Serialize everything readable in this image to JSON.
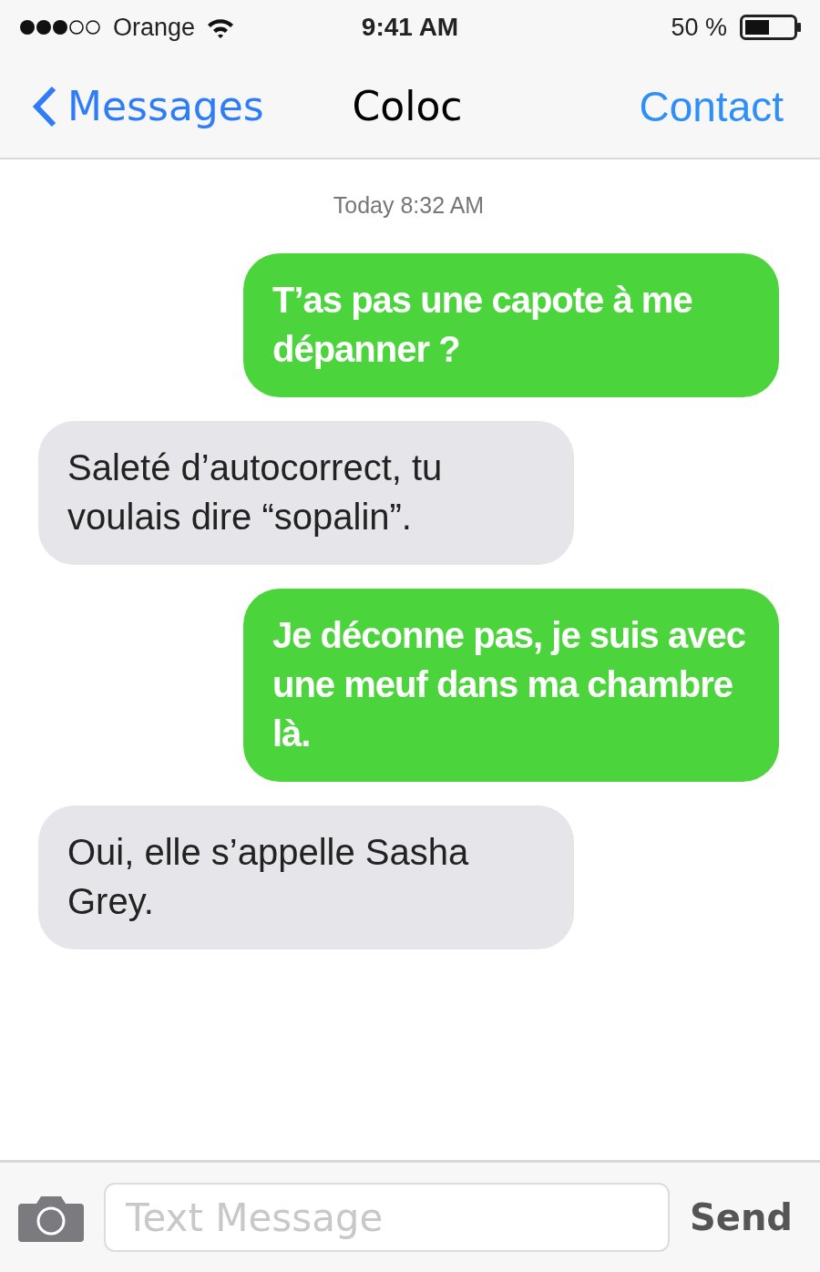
{
  "status_bar": {
    "carrier": "Orange",
    "time": "9:41 AM",
    "battery": "50 %"
  },
  "nav": {
    "back": "Messages",
    "title": "Coloc",
    "action": "Contact"
  },
  "timestamp": "Today 8:32 AM",
  "messages": [
    {
      "kind": "sent",
      "text": "T’as pas une capote à me dépanner ?"
    },
    {
      "kind": "received",
      "text": "Saleté d’autocorrect, tu voulais dire “sopalin”."
    },
    {
      "kind": "sent",
      "text": "Je déconne pas, je suis avec une meuf dans ma chambre là."
    },
    {
      "kind": "received",
      "text": "Oui, elle s’appelle Sasha Grey."
    }
  ],
  "composer": {
    "placeholder": "Text Message",
    "send": "Send"
  }
}
